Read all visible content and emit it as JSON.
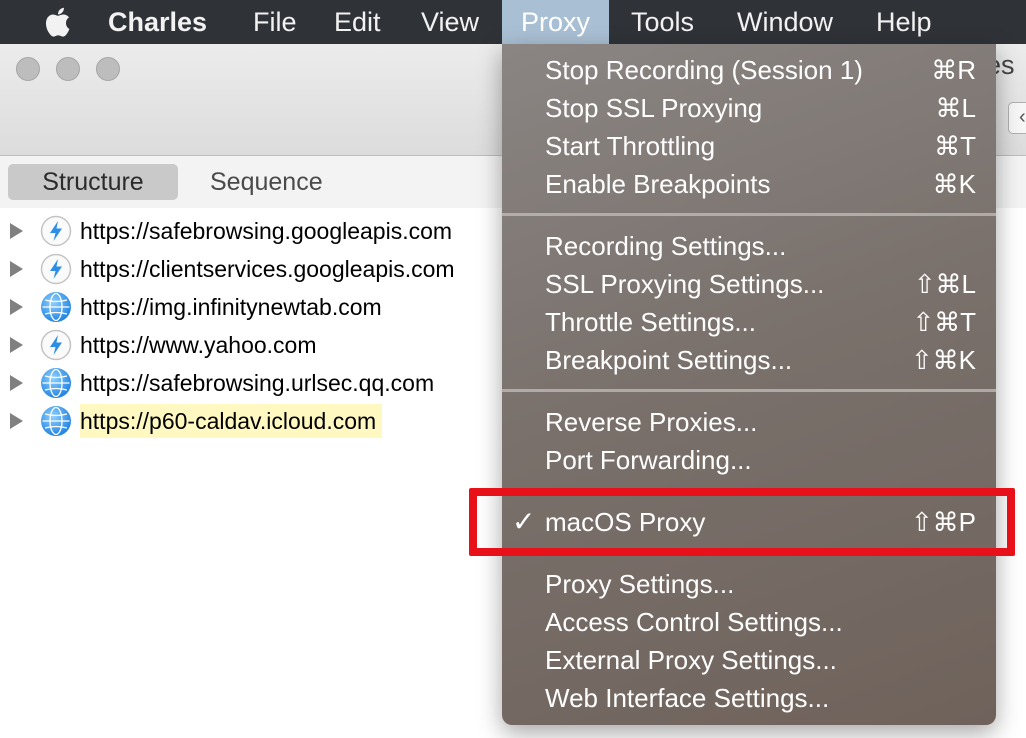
{
  "menubar": {
    "apple": "apple-logo-icon",
    "app_name": "Charles",
    "items": [
      "File",
      "Edit",
      "View",
      "Proxy",
      "Tools",
      "Window",
      "Help"
    ]
  },
  "window": {
    "title_fragment": "es",
    "tabs": [
      "Structure",
      "Sequence"
    ]
  },
  "hosts": [
    {
      "url": "https://safebrowsing.googleapis.com",
      "icon": "lightning-icon"
    },
    {
      "url": "https://clientservices.googleapis.com",
      "icon": "lightning-icon"
    },
    {
      "url": "https://img.infinitynewtab.com",
      "icon": "globe-icon"
    },
    {
      "url": "https://www.yahoo.com",
      "icon": "lightning-icon"
    },
    {
      "url": "https://safebrowsing.urlsec.qq.com",
      "icon": "globe-icon"
    },
    {
      "url": "https://p60-caldav.icloud.com",
      "icon": "globe-icon"
    }
  ],
  "proxy_menu": {
    "g1": [
      {
        "label": "Stop Recording (Session 1)",
        "shortcut": "⌘R"
      },
      {
        "label": "Stop SSL Proxying",
        "shortcut": "⌘L"
      },
      {
        "label": "Start Throttling",
        "shortcut": "⌘T"
      },
      {
        "label": "Enable Breakpoints",
        "shortcut": "⌘K"
      }
    ],
    "g2": [
      {
        "label": "Recording Settings...",
        "shortcut": ""
      },
      {
        "label": "SSL Proxying Settings...",
        "shortcut": "⇧⌘L"
      },
      {
        "label": "Throttle Settings...",
        "shortcut": "⇧⌘T"
      },
      {
        "label": "Breakpoint Settings...",
        "shortcut": "⇧⌘K"
      }
    ],
    "g3": [
      {
        "label": "Reverse Proxies...",
        "shortcut": ""
      },
      {
        "label": "Port Forwarding...",
        "shortcut": ""
      }
    ],
    "g4": [
      {
        "label": "macOS Proxy",
        "shortcut": "⇧⌘P",
        "check": "✓"
      }
    ],
    "g5": [
      {
        "label": "Proxy Settings...",
        "shortcut": ""
      },
      {
        "label": "Access Control Settings...",
        "shortcut": ""
      },
      {
        "label": "External Proxy Settings...",
        "shortcut": ""
      },
      {
        "label": "Web Interface Settings...",
        "shortcut": ""
      }
    ]
  },
  "colors": {
    "menubar_bg": "#2f3338",
    "menu_active": "#a9bfd3",
    "highlight_red": "#e8111a",
    "selected_row_bg": "#fff8c0"
  }
}
